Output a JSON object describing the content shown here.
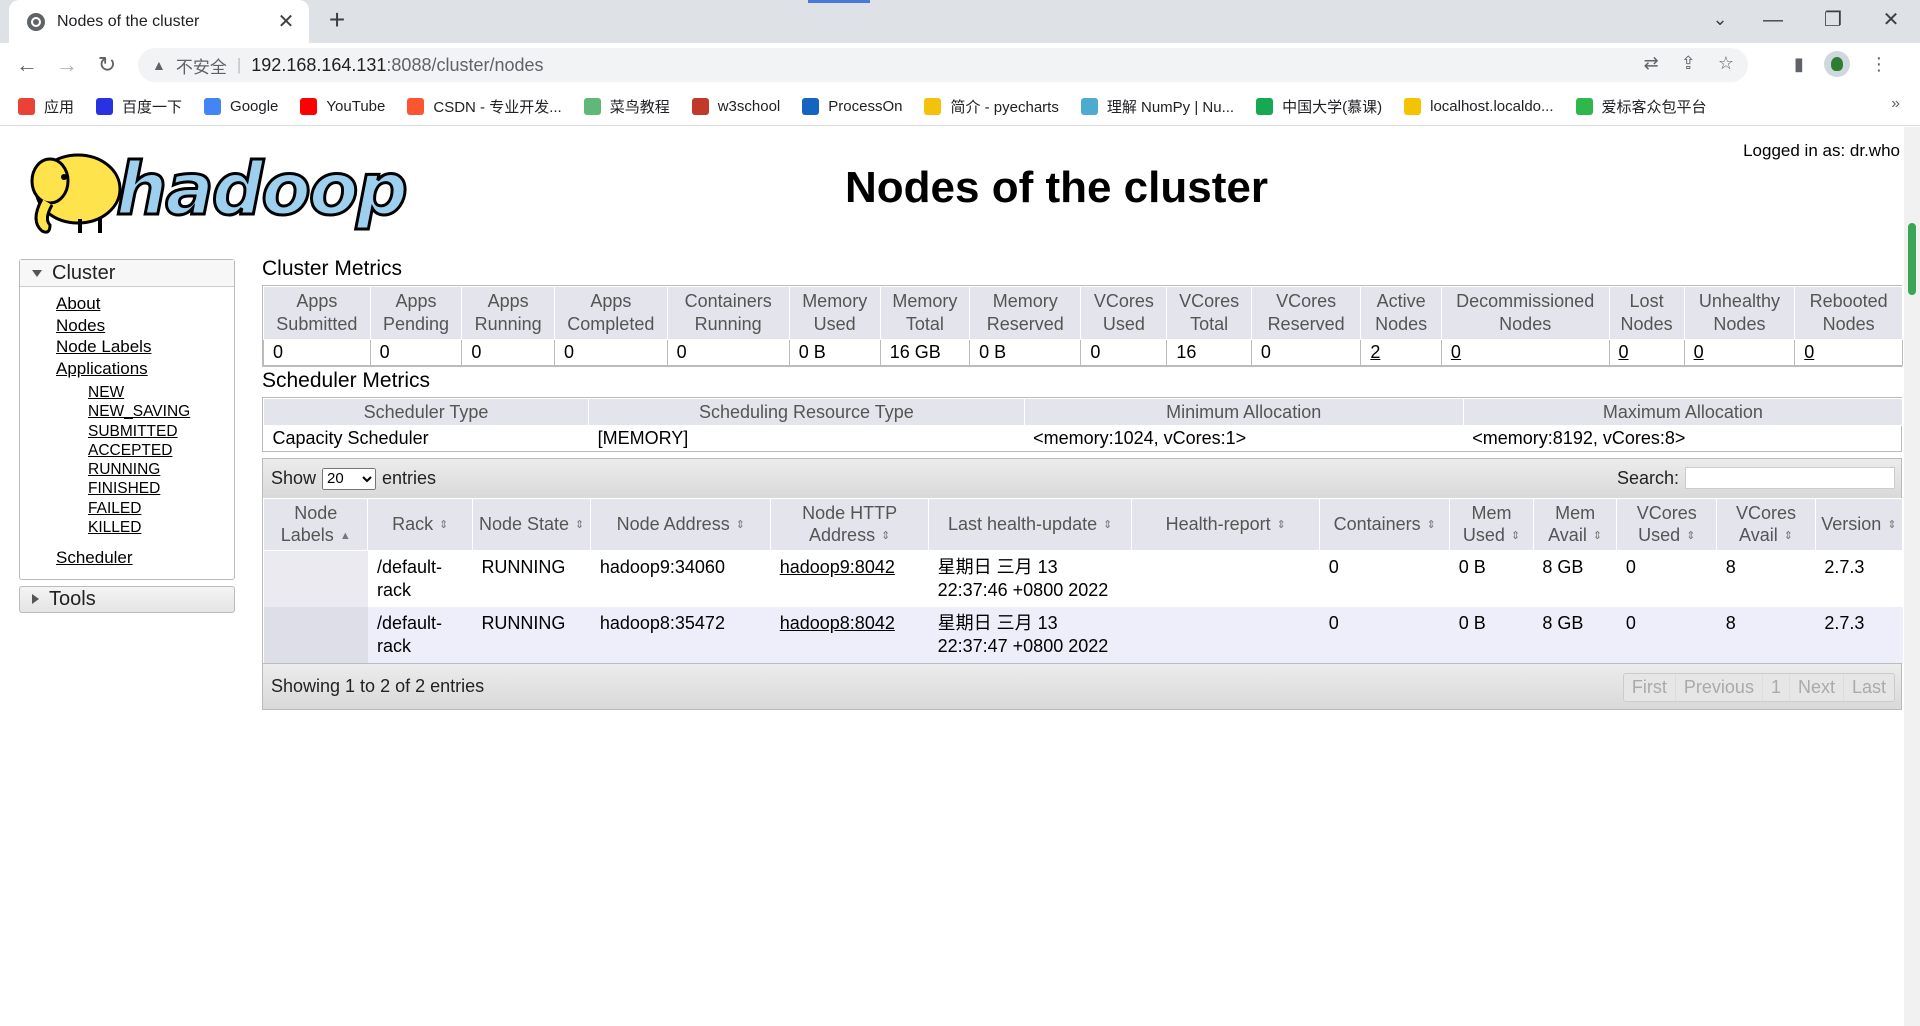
{
  "browser": {
    "tab_title": "Nodes of the cluster",
    "tab_close": "✕",
    "new_tab": "+",
    "address": {
      "security_label": "不安全",
      "host": "192.168.164.131",
      "path": ":8088/cluster/nodes"
    },
    "bookmarks": [
      {
        "label": "应用",
        "color": "#ea4335"
      },
      {
        "label": "百度一下",
        "color": "#2932e1"
      },
      {
        "label": "Google",
        "color": "#4285f4"
      },
      {
        "label": "YouTube",
        "color": "#ff0000"
      },
      {
        "label": "CSDN - 专业开发...",
        "color": "#fc5531"
      },
      {
        "label": "菜鸟教程",
        "color": "#5fb878"
      },
      {
        "label": "w3school",
        "color": "#c0392b"
      },
      {
        "label": "ProcessOn",
        "color": "#1565c0"
      },
      {
        "label": "简介 - pyecharts",
        "color": "#f4c20d"
      },
      {
        "label": "理解 NumPy | Nu...",
        "color": "#4dabcf"
      },
      {
        "label": "中国大学(慕课)",
        "color": "#16a951"
      },
      {
        "label": "localhost.localdo...",
        "color": "#f5c400"
      },
      {
        "label": "爱标客众包平台",
        "color": "#2eb84c"
      }
    ],
    "bookmarks_more": "»"
  },
  "page": {
    "title": "Nodes of the cluster",
    "logo_text": "hadoop",
    "logged_in": "Logged in as: dr.who"
  },
  "sidebar": {
    "cluster_label": "Cluster",
    "links": {
      "about": "About",
      "nodes": "Nodes",
      "node_labels": "Node Labels",
      "applications": "Applications"
    },
    "app_states": [
      "NEW",
      "NEW_SAVING",
      "SUBMITTED",
      "ACCEPTED",
      "RUNNING",
      "FINISHED",
      "FAILED",
      "KILLED"
    ],
    "scheduler": "Scheduler",
    "tools_label": "Tools"
  },
  "cluster_metrics": {
    "title": "Cluster Metrics",
    "headers": [
      "Apps Submitted",
      "Apps Pending",
      "Apps Running",
      "Apps Completed",
      "Containers Running",
      "Memory Used",
      "Memory Total",
      "Memory Reserved",
      "VCores Used",
      "VCores Total",
      "VCores Reserved",
      "Active Nodes",
      "Decommissioned Nodes",
      "Lost Nodes",
      "Unhealthy Nodes",
      "Rebooted Nodes"
    ],
    "values": [
      "0",
      "0",
      "0",
      "0",
      "0",
      "0 B",
      "16 GB",
      "0 B",
      "0",
      "16",
      "0",
      "2",
      "0",
      "0",
      "0",
      "0"
    ]
  },
  "scheduler_metrics": {
    "title": "Scheduler Metrics",
    "headers": [
      "Scheduler Type",
      "Scheduling Resource Type",
      "Minimum Allocation",
      "Maximum Allocation"
    ],
    "values": [
      "Capacity Scheduler",
      "[MEMORY]",
      "<memory:1024, vCores:1>",
      "<memory:8192, vCores:8>"
    ]
  },
  "nodes_table": {
    "show_label": "Show",
    "entries_label": "entries",
    "page_size": "20",
    "search_label": "Search:",
    "headers": [
      "Node Labels",
      "Rack",
      "Node State",
      "Node Address",
      "Node HTTP Address",
      "Last health-update",
      "Health-report",
      "Containers",
      "Mem Used",
      "Mem Avail",
      "VCores Used",
      "VCores Avail",
      "Version"
    ],
    "rows": [
      {
        "labels": "",
        "rack": "/default-rack",
        "state": "RUNNING",
        "address": "hadoop9:34060",
        "http": "hadoop9:8042",
        "health_update": "星期日 三月 13 22:37:46 +0800 2022",
        "health_report": "",
        "containers": "0",
        "mem_used": "0 B",
        "mem_avail": "8 GB",
        "vcores_used": "0",
        "vcores_avail": "8",
        "version": "2.7.3"
      },
      {
        "labels": "",
        "rack": "/default-rack",
        "state": "RUNNING",
        "address": "hadoop8:35472",
        "http": "hadoop8:8042",
        "health_update": "星期日 三月 13 22:37:47 +0800 2022",
        "health_report": "",
        "containers": "0",
        "mem_used": "0 B",
        "mem_avail": "8 GB",
        "vcores_used": "0",
        "vcores_avail": "8",
        "version": "2.7.3"
      }
    ],
    "info": "Showing 1 to 2 of 2 entries",
    "pager": [
      "First",
      "Previous",
      "1",
      "Next",
      "Last"
    ]
  }
}
